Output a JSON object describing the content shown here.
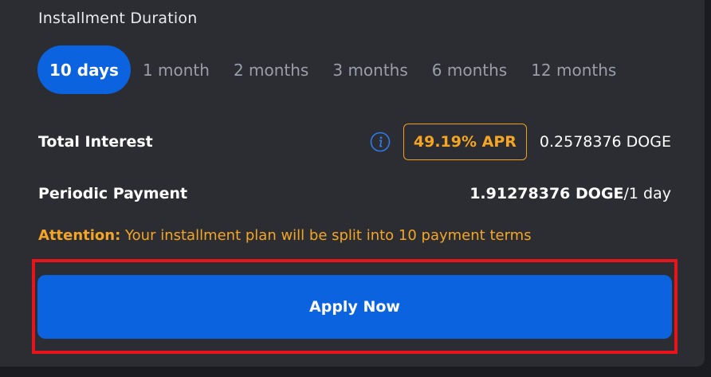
{
  "installment": {
    "title": "Installment Duration",
    "tabs": [
      {
        "label": "10 days",
        "active": true
      },
      {
        "label": "1 month",
        "active": false
      },
      {
        "label": "2 months",
        "active": false
      },
      {
        "label": "3 months",
        "active": false
      },
      {
        "label": "6 months",
        "active": false
      },
      {
        "label": "12 months",
        "active": false
      }
    ]
  },
  "total_interest": {
    "label": "Total Interest",
    "info_icon": "info-icon",
    "apr": "49.19% APR",
    "value": "0.2578376 DOGE"
  },
  "periodic_payment": {
    "label": "Periodic Payment",
    "amount": "1.91278376 DOGE",
    "unit": "/1 day"
  },
  "attention": {
    "prefix": "Attention:",
    "message": " Your installment plan will be split into 10 payment terms"
  },
  "apply": {
    "label": "Apply Now"
  },
  "colors": {
    "accent": "#0b63e0",
    "warning": "#f5a524",
    "highlight": "#e8141b",
    "panel": "#2b2d33"
  }
}
